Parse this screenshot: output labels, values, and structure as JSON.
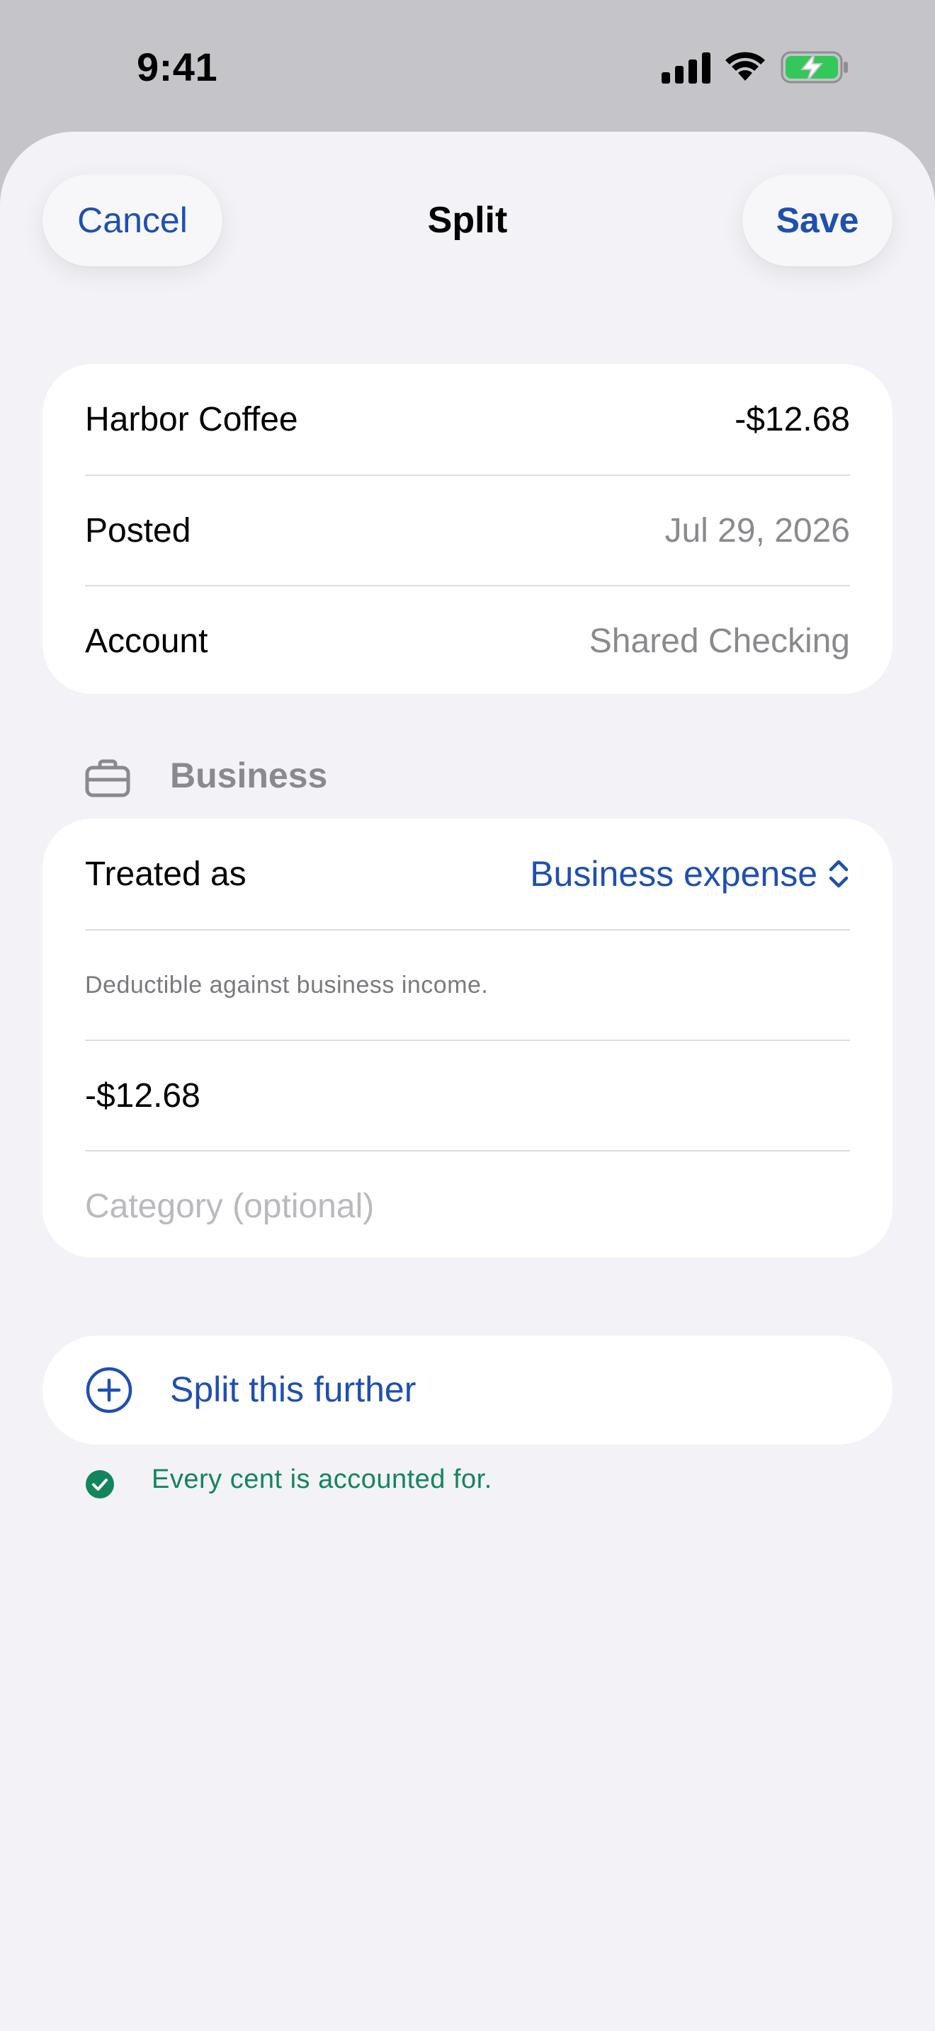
{
  "status_bar": {
    "time": "9:41",
    "icons": [
      "cellular-signal-icon",
      "wifi-icon",
      "battery-charging-icon"
    ]
  },
  "nav": {
    "cancel_label": "Cancel",
    "title": "Split",
    "save_label": "Save"
  },
  "transaction": {
    "payee": "Harbor Coffee",
    "amount": "-$12.68",
    "posted_label": "Posted",
    "posted_date": "Jul 29, 2026",
    "account_label": "Account",
    "account_value": "Shared Checking"
  },
  "business_section": {
    "icon": "briefcase-icon",
    "title": "Business",
    "treated_as_label": "Treated as",
    "treated_as_value": "Business expense",
    "note": "Deductible against business income.",
    "amount": "-$12.68",
    "category_placeholder": "Category (optional)"
  },
  "split_further": {
    "icon": "plus-circle-icon",
    "label": "Split this further"
  },
  "balance_status": {
    "icon": "checkmark-circle-icon",
    "text": "Every cent is accounted for."
  },
  "colors": {
    "accent": "#1f4fb0",
    "success": "#13855c",
    "sheet_background": "#f2f2f7",
    "secondary_text": "#8a8a8e"
  }
}
